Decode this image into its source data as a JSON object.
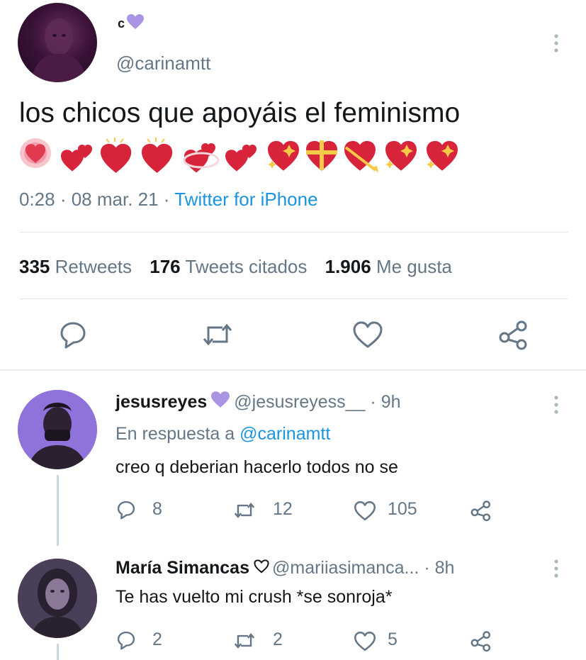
{
  "tweet": {
    "display_name": "c",
    "handle": "@carinamtt",
    "text": "los chicos que apoyáis el feminismo",
    "emoji_row": [
      "revolving-hearts-emoji",
      "sparkling-heart-emoji",
      "heart-emoji",
      "heart-emoji",
      "heart-with-ribbon-emoji",
      "sparkling-heart-emoji",
      "sparkle-heart-emoji",
      "gift-heart-emoji",
      "arrow-heart-emoji",
      "sparkle-heart-emoji",
      "sparkle-heart-emoji"
    ],
    "time": "0:28",
    "date": "08 mar. 21",
    "source": "Twitter for iPhone",
    "stats": {
      "retweets_count": "335",
      "retweets_label": "Retweets",
      "quotes_count": "176",
      "quotes_label": "Tweets citados",
      "likes_count": "1.906",
      "likes_label": "Me gusta"
    }
  },
  "replies": [
    {
      "name": "jesusreyes",
      "handle": "@jesusreyess__",
      "time": "9h",
      "reply_to_prefix": "En respuesta a",
      "reply_to_handle": "@carinamtt",
      "text": "creo q deberian hacerlo todos no se",
      "comments": "8",
      "retweets": "12",
      "likes": "105"
    },
    {
      "name": "María Simancas",
      "handle": "@mariiasimanca...",
      "time": "8h",
      "text": "Te has vuelto mi crush *se sonroja*",
      "comments": "2",
      "retweets": "2",
      "likes": "5"
    }
  ],
  "colors": {
    "accent": "#1b95e0",
    "muted": "#657786",
    "purple_heart": "#a995e3",
    "emoji_red": "#d8243a"
  }
}
